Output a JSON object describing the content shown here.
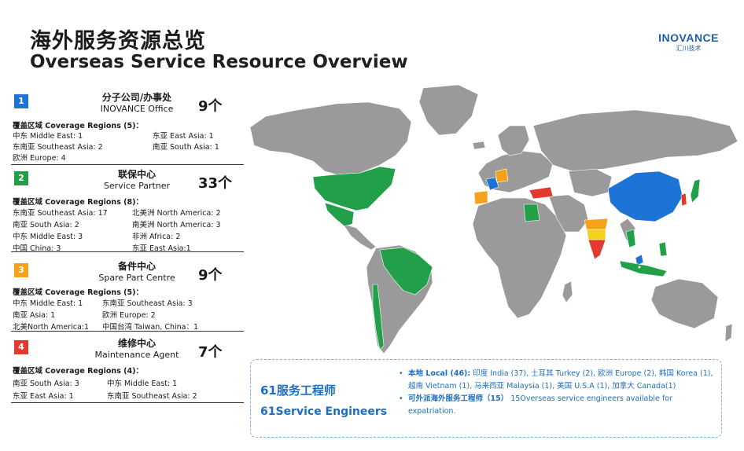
{
  "header": {
    "title_cn": "海外服务资源总览",
    "title_en": "Overseas Service Resource Overview",
    "logo_text": "INOVANCE",
    "logo_sub": "汇川技术"
  },
  "panels": [
    {
      "index": "1",
      "title_cn": "分子公司/办事处",
      "title_en": "INOVANCE Office",
      "count": "9个",
      "coverage": "覆盖区域 Coverage Regions (5)：",
      "regions": [
        "中东 Middle East: 1",
        "东亚 East Asia: 1",
        "东南亚 Southeast Asia: 2",
        "南亚 South Asia: 1",
        "欧洲 Europe: 4"
      ]
    },
    {
      "index": "2",
      "title_cn": "联保中心",
      "title_en": "Service Partner",
      "count": "33个",
      "coverage": "覆盖区域 Coverage Regions (8)：",
      "regions": [
        "东南亚 Southeast Asia: 17",
        "北美洲 North America: 2",
        "南亚 South Asia: 2",
        "南美洲 North America: 3",
        "中东 Middle East: 3",
        "非洲 Africa: 2",
        "中国 China: 3",
        "东亚 East Asia:1"
      ]
    },
    {
      "index": "3",
      "title_cn": "备件中心",
      "title_en": "Spare Part Centre",
      "count": "9个",
      "coverage": "覆盖区域 Coverage Regions (5)：",
      "regions": [
        "中东 Middle East: 1",
        "东南亚 Southeast Asia: 3",
        "南亚 Asia: 1",
        "欧洲 Europe: 2",
        "北美North America:1",
        "中国台湾 Taiwan, China：1"
      ]
    },
    {
      "index": "4",
      "title_cn": "维修中心",
      "title_en": "Maintenance Agent",
      "count": "7个",
      "coverage": "覆盖区域 Coverage Regions (4)：",
      "regions": [
        "南亚 South Asia: 3",
        "中东 Middle East: 1",
        "东亚 East Asia: 1",
        "东南亚 Southeast Asia: 2"
      ]
    }
  ],
  "engineers": {
    "count_cn": "61服务工程师",
    "count_en": "61Service Engineers",
    "local_label": "本地 Local (46):",
    "local_text": " 印度 India (37), 土耳其 Turkey (2), 欧洲 Europe (2), 韩国 Korea (1), 越南 Vietnam (1), 马来西亚 Malaysia (1), 美国 U.S.A (1), 加拿大 Canada(1)",
    "expat_label": "可外派海外服务工程师（15）",
    "expat_text": " 15Overseas service engineers available for expatriation."
  },
  "colors": {
    "office": "#1e73d6",
    "partner": "#22a049",
    "spare": "#f5a11c",
    "maintenance": "#e23a2e",
    "land": "#9a9a9a"
  }
}
